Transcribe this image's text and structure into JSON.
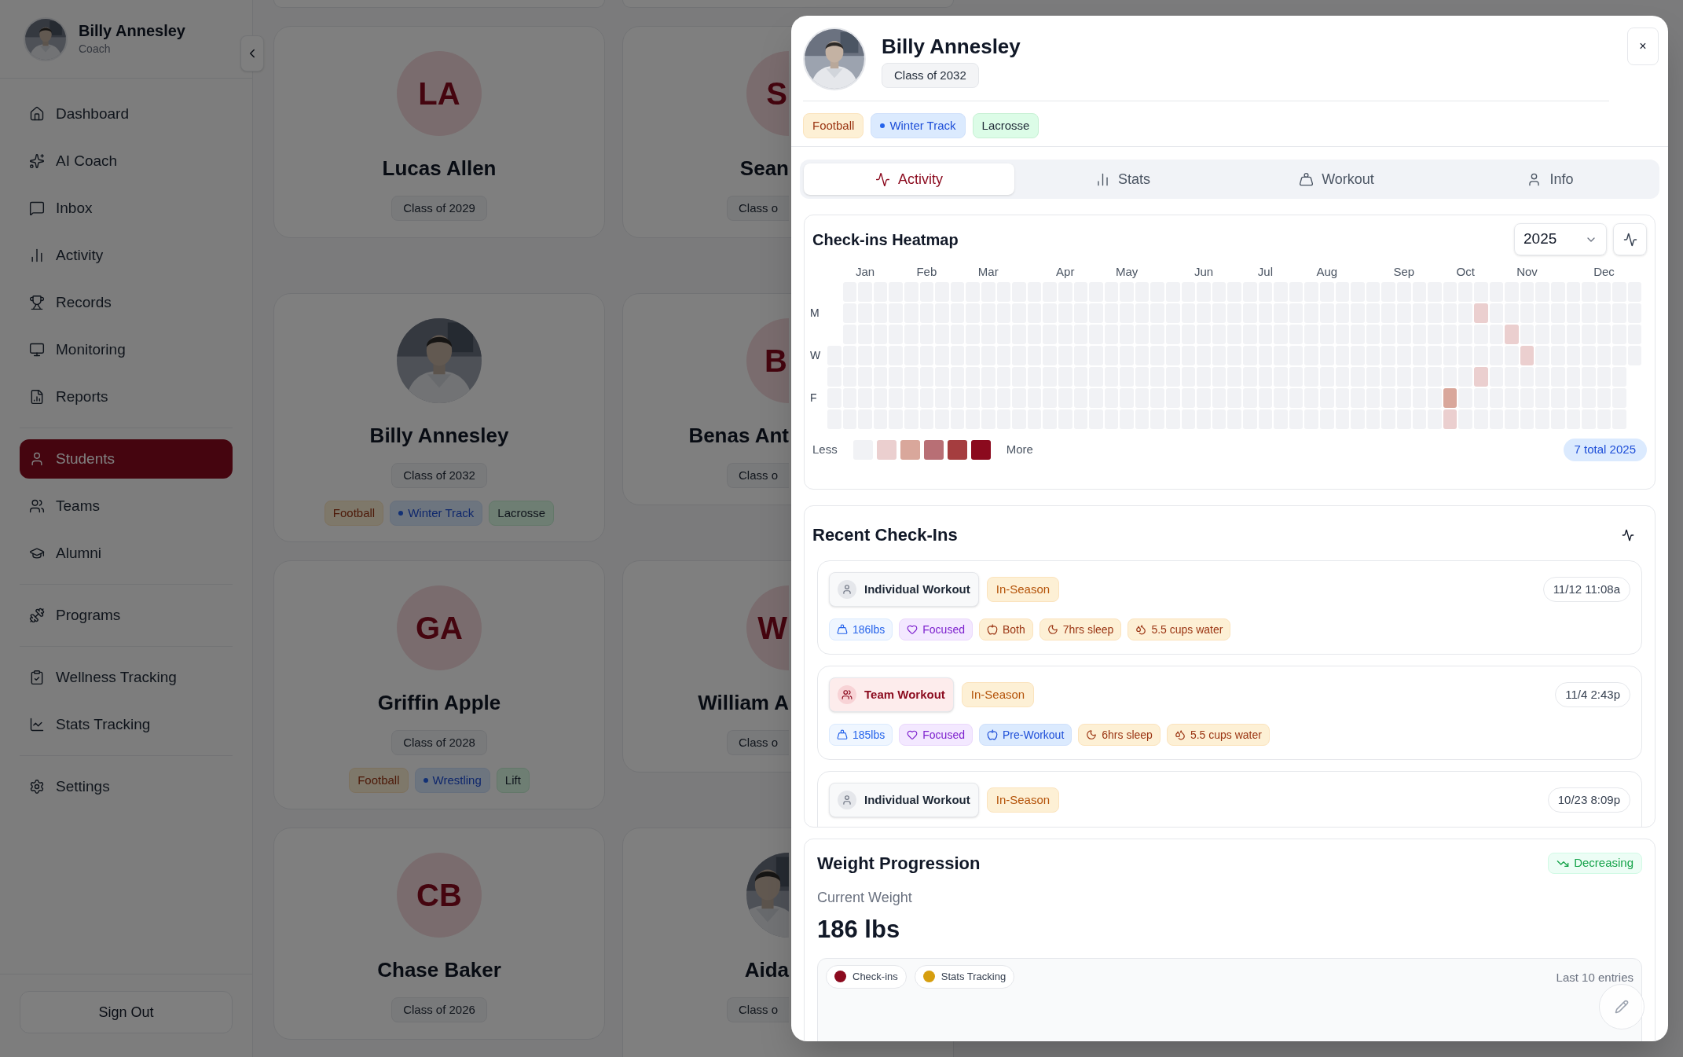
{
  "sidebar": {
    "user": {
      "name": "Billy Annesley",
      "role": "Coach"
    },
    "groups": [
      {
        "items": [
          {
            "label": "Dashboard",
            "selected": false
          },
          {
            "label": "AI Coach",
            "selected": false
          },
          {
            "label": "Inbox",
            "selected": false
          },
          {
            "label": "Activity",
            "selected": false
          },
          {
            "label": "Records",
            "selected": false
          },
          {
            "label": "Monitoring",
            "selected": false
          },
          {
            "label": "Reports",
            "selected": false
          }
        ]
      },
      {
        "items": [
          {
            "label": "Students",
            "selected": true
          },
          {
            "label": "Teams",
            "selected": false
          },
          {
            "label": "Alumni",
            "selected": false
          }
        ]
      },
      {
        "items": [
          {
            "label": "Programs",
            "selected": false
          }
        ]
      },
      {
        "items": [
          {
            "label": "Wellness Tracking",
            "selected": false
          },
          {
            "label": "Stats Tracking",
            "selected": false
          }
        ]
      },
      {
        "items": [
          {
            "label": "Settings",
            "selected": false
          }
        ]
      }
    ],
    "sign_out": "Sign Out"
  },
  "students": {
    "columns": [
      {
        "cards": [
          {
            "kind": "initials",
            "initials": "LA",
            "name": "Lucas Allen",
            "class": "Class of 2029"
          },
          {
            "name": "Billy Annesley",
            "class": "Class of 2032",
            "tags": [
              {
                "label": "Football",
                "dot": false
              },
              {
                "label": "Winter Track",
                "dot": true
              },
              {
                "label": "Lacrosse",
                "dot": false
              }
            ]
          },
          {
            "kind": "initials",
            "initials": "GA",
            "name": "Griffin Apple",
            "class": "Class of 2028",
            "tags": [
              {
                "label": "Football",
                "dot": false
              },
              {
                "label": "Wrestling",
                "dot": true
              },
              {
                "label": "Lift",
                "dot": false
              }
            ]
          },
          {
            "kind": "initials",
            "initials": "CB",
            "name": "Chase Baker",
            "class": "Class of 2026"
          }
        ]
      },
      {
        "cards": [
          {
            "kind": "initials",
            "initials": "S",
            "name": "Sean",
            "class": "Class o"
          },
          {
            "kind": "initials",
            "initials": "B",
            "name": "Benas Ant",
            "class": "Class o"
          },
          {
            "kind": "initials",
            "initials": "W",
            "name": "William A",
            "class": "Class o"
          },
          {
            "name": "Aida",
            "class": "Class o"
          }
        ]
      }
    ]
  },
  "profile": {
    "name": "Billy Annesley",
    "class": "Class of 2032",
    "close": "×",
    "tags": [
      {
        "label": "Football",
        "color": "#fdf0d5",
        "dot": false
      },
      {
        "label": "Winter Track",
        "color": "#dbeafe",
        "dot": true
      },
      {
        "label": "Lacrosse",
        "color": "#dcfce7",
        "dot": false
      }
    ],
    "tabs": [
      {
        "label": "Activity",
        "selected": true
      },
      {
        "label": "Stats",
        "selected": false
      },
      {
        "label": "Workout",
        "selected": false
      },
      {
        "label": "Info",
        "selected": false
      }
    ],
    "heatmap": {
      "title": "Check-ins Heatmap",
      "year": "2025",
      "months": [
        {
          "label": "Jan"
        },
        {
          "label": "Feb"
        },
        {
          "label": "Mar"
        },
        {
          "label": "Apr"
        },
        {
          "label": "May"
        },
        {
          "label": "Jun"
        },
        {
          "label": "Jul"
        },
        {
          "label": "Aug"
        },
        {
          "label": "Sep"
        },
        {
          "label": "Oct"
        },
        {
          "label": "Nov"
        },
        {
          "label": "Dec"
        }
      ],
      "rows": [
        {
          "cells": [
            null,
            {
              "kind": "empty"
            },
            {
              "kind": "empty"
            },
            {
              "kind": "empty"
            },
            {
              "kind": "empty"
            },
            {
              "kind": "empty"
            },
            {
              "kind": "empty"
            },
            {
              "kind": "empty"
            },
            {
              "kind": "empty"
            },
            {
              "kind": "empty"
            },
            {
              "kind": "empty"
            },
            {
              "kind": "empty"
            },
            {
              "kind": "empty"
            },
            {
              "kind": "empty"
            },
            {
              "kind": "empty"
            },
            {
              "kind": "empty"
            },
            {
              "kind": "empty"
            },
            {
              "kind": "empty"
            },
            {
              "kind": "empty"
            },
            {
              "kind": "empty"
            },
            {
              "kind": "empty"
            },
            {
              "kind": "empty"
            },
            {
              "kind": "empty"
            },
            {
              "kind": "empty"
            },
            {
              "kind": "empty"
            },
            {
              "kind": "empty"
            },
            {
              "kind": "empty"
            },
            {
              "kind": "empty"
            },
            {
              "kind": "empty"
            },
            {
              "kind": "empty"
            },
            {
              "kind": "empty"
            },
            {
              "kind": "empty"
            },
            {
              "kind": "empty"
            },
            {
              "kind": "empty"
            },
            {
              "kind": "empty"
            },
            {
              "kind": "empty"
            },
            {
              "kind": "empty"
            },
            {
              "kind": "empty"
            },
            {
              "kind": "empty"
            },
            {
              "kind": "empty"
            },
            {
              "kind": "empty"
            },
            {
              "kind": "empty"
            },
            {
              "kind": "empty"
            },
            {
              "kind": "empty"
            },
            {
              "kind": "empty"
            },
            {
              "kind": "empty"
            },
            {
              "kind": "empty"
            },
            {
              "kind": "empty"
            },
            {
              "kind": "empty"
            },
            {
              "kind": "empty"
            },
            {
              "kind": "empty"
            },
            {
              "kind": "empty"
            },
            {
              "kind": "empty"
            }
          ]
        },
        {
          "label": "M",
          "cells": [
            null,
            {
              "kind": "empty"
            },
            {
              "kind": "empty"
            },
            {
              "kind": "empty"
            },
            {
              "kind": "empty"
            },
            {
              "kind": "empty"
            },
            {
              "kind": "empty"
            },
            {
              "kind": "empty"
            },
            {
              "kind": "empty"
            },
            {
              "kind": "empty"
            },
            {
              "kind": "empty"
            },
            {
              "kind": "empty"
            },
            {
              "kind": "empty"
            },
            {
              "kind": "empty"
            },
            {
              "kind": "empty"
            },
            {
              "kind": "empty"
            },
            {
              "kind": "empty"
            },
            {
              "kind": "empty"
            },
            {
              "kind": "empty"
            },
            {
              "kind": "empty"
            },
            {
              "kind": "empty"
            },
            {
              "kind": "empty"
            },
            {
              "kind": "empty"
            },
            {
              "kind": "empty"
            },
            {
              "kind": "empty"
            },
            {
              "kind": "empty"
            },
            {
              "kind": "empty"
            },
            {
              "kind": "empty"
            },
            {
              "kind": "empty"
            },
            {
              "kind": "empty"
            },
            {
              "kind": "empty"
            },
            {
              "kind": "empty"
            },
            {
              "kind": "empty"
            },
            {
              "kind": "empty"
            },
            {
              "kind": "empty"
            },
            {
              "kind": "empty"
            },
            {
              "kind": "empty"
            },
            {
              "kind": "empty"
            },
            {
              "kind": "empty"
            },
            {
              "kind": "empty"
            },
            {
              "kind": "empty"
            },
            {
              "kind": "empty"
            },
            {
              "kind": "light"
            },
            {
              "kind": "empty"
            },
            {
              "kind": "empty"
            },
            {
              "kind": "empty"
            },
            {
              "kind": "empty"
            },
            {
              "kind": "empty"
            },
            {
              "kind": "empty"
            },
            {
              "kind": "empty"
            },
            {
              "kind": "empty"
            },
            {
              "kind": "empty"
            },
            {
              "kind": "empty"
            }
          ]
        },
        {
          "cells": [
            null,
            {
              "kind": "empty"
            },
            {
              "kind": "empty"
            },
            {
              "kind": "empty"
            },
            {
              "kind": "empty"
            },
            {
              "kind": "empty"
            },
            {
              "kind": "empty"
            },
            {
              "kind": "empty"
            },
            {
              "kind": "empty"
            },
            {
              "kind": "empty"
            },
            {
              "kind": "empty"
            },
            {
              "kind": "empty"
            },
            {
              "kind": "empty"
            },
            {
              "kind": "empty"
            },
            {
              "kind": "empty"
            },
            {
              "kind": "empty"
            },
            {
              "kind": "empty"
            },
            {
              "kind": "empty"
            },
            {
              "kind": "empty"
            },
            {
              "kind": "empty"
            },
            {
              "kind": "empty"
            },
            {
              "kind": "empty"
            },
            {
              "kind": "empty"
            },
            {
              "kind": "empty"
            },
            {
              "kind": "empty"
            },
            {
              "kind": "empty"
            },
            {
              "kind": "empty"
            },
            {
              "kind": "empty"
            },
            {
              "kind": "empty"
            },
            {
              "kind": "empty"
            },
            {
              "kind": "empty"
            },
            {
              "kind": "empty"
            },
            {
              "kind": "empty"
            },
            {
              "kind": "empty"
            },
            {
              "kind": "empty"
            },
            {
              "kind": "empty"
            },
            {
              "kind": "empty"
            },
            {
              "kind": "empty"
            },
            {
              "kind": "empty"
            },
            {
              "kind": "empty"
            },
            {
              "kind": "empty"
            },
            {
              "kind": "empty"
            },
            {
              "kind": "empty"
            },
            {
              "kind": "empty"
            },
            {
              "kind": "light"
            },
            {
              "kind": "empty"
            },
            {
              "kind": "empty"
            },
            {
              "kind": "empty"
            },
            {
              "kind": "empty"
            },
            {
              "kind": "empty"
            },
            {
              "kind": "empty"
            },
            {
              "kind": "empty"
            },
            {
              "kind": "empty"
            }
          ]
        },
        {
          "label": "W",
          "cells": [
            {
              "kind": "empty"
            },
            {
              "kind": "empty"
            },
            {
              "kind": "empty"
            },
            {
              "kind": "empty"
            },
            {
              "kind": "empty"
            },
            {
              "kind": "empty"
            },
            {
              "kind": "empty"
            },
            {
              "kind": "empty"
            },
            {
              "kind": "empty"
            },
            {
              "kind": "empty"
            },
            {
              "kind": "empty"
            },
            {
              "kind": "empty"
            },
            {
              "kind": "empty"
            },
            {
              "kind": "empty"
            },
            {
              "kind": "empty"
            },
            {
              "kind": "empty"
            },
            {
              "kind": "empty"
            },
            {
              "kind": "empty"
            },
            {
              "kind": "empty"
            },
            {
              "kind": "empty"
            },
            {
              "kind": "empty"
            },
            {
              "kind": "empty"
            },
            {
              "kind": "empty"
            },
            {
              "kind": "empty"
            },
            {
              "kind": "empty"
            },
            {
              "kind": "empty"
            },
            {
              "kind": "empty"
            },
            {
              "kind": "empty"
            },
            {
              "kind": "empty"
            },
            {
              "kind": "empty"
            },
            {
              "kind": "empty"
            },
            {
              "kind": "empty"
            },
            {
              "kind": "empty"
            },
            {
              "kind": "empty"
            },
            {
              "kind": "empty"
            },
            {
              "kind": "empty"
            },
            {
              "kind": "empty"
            },
            {
              "kind": "empty"
            },
            {
              "kind": "empty"
            },
            {
              "kind": "empty"
            },
            {
              "kind": "empty"
            },
            {
              "kind": "empty"
            },
            {
              "kind": "empty"
            },
            {
              "kind": "empty"
            },
            {
              "kind": "empty"
            },
            {
              "kind": "light"
            },
            {
              "kind": "empty"
            },
            {
              "kind": "empty"
            },
            {
              "kind": "empty"
            },
            {
              "kind": "empty"
            },
            {
              "kind": "empty"
            },
            {
              "kind": "empty"
            },
            {
              "kind": "empty"
            }
          ]
        },
        {
          "cells": [
            {
              "kind": "empty"
            },
            {
              "kind": "empty"
            },
            {
              "kind": "empty"
            },
            {
              "kind": "empty"
            },
            {
              "kind": "empty"
            },
            {
              "kind": "empty"
            },
            {
              "kind": "empty"
            },
            {
              "kind": "empty"
            },
            {
              "kind": "empty"
            },
            {
              "kind": "empty"
            },
            {
              "kind": "empty"
            },
            {
              "kind": "empty"
            },
            {
              "kind": "empty"
            },
            {
              "kind": "empty"
            },
            {
              "kind": "empty"
            },
            {
              "kind": "empty"
            },
            {
              "kind": "empty"
            },
            {
              "kind": "empty"
            },
            {
              "kind": "empty"
            },
            {
              "kind": "empty"
            },
            {
              "kind": "empty"
            },
            {
              "kind": "empty"
            },
            {
              "kind": "empty"
            },
            {
              "kind": "empty"
            },
            {
              "kind": "empty"
            },
            {
              "kind": "empty"
            },
            {
              "kind": "empty"
            },
            {
              "kind": "empty"
            },
            {
              "kind": "empty"
            },
            {
              "kind": "empty"
            },
            {
              "kind": "empty"
            },
            {
              "kind": "empty"
            },
            {
              "kind": "empty"
            },
            {
              "kind": "empty"
            },
            {
              "kind": "empty"
            },
            {
              "kind": "empty"
            },
            {
              "kind": "empty"
            },
            {
              "kind": "empty"
            },
            {
              "kind": "empty"
            },
            {
              "kind": "empty"
            },
            {
              "kind": "empty"
            },
            {
              "kind": "empty"
            },
            {
              "kind": "light"
            },
            {
              "kind": "empty"
            },
            {
              "kind": "empty"
            },
            {
              "kind": "empty"
            },
            {
              "kind": "empty"
            },
            {
              "kind": "empty"
            },
            {
              "kind": "empty"
            },
            {
              "kind": "empty"
            },
            {
              "kind": "empty"
            },
            {
              "kind": "empty"
            },
            null
          ]
        },
        {
          "label": "F",
          "cells": [
            {
              "kind": "empty"
            },
            {
              "kind": "empty"
            },
            {
              "kind": "empty"
            },
            {
              "kind": "empty"
            },
            {
              "kind": "empty"
            },
            {
              "kind": "empty"
            },
            {
              "kind": "empty"
            },
            {
              "kind": "empty"
            },
            {
              "kind": "empty"
            },
            {
              "kind": "empty"
            },
            {
              "kind": "empty"
            },
            {
              "kind": "empty"
            },
            {
              "kind": "empty"
            },
            {
              "kind": "empty"
            },
            {
              "kind": "empty"
            },
            {
              "kind": "empty"
            },
            {
              "kind": "empty"
            },
            {
              "kind": "empty"
            },
            {
              "kind": "empty"
            },
            {
              "kind": "empty"
            },
            {
              "kind": "empty"
            },
            {
              "kind": "empty"
            },
            {
              "kind": "empty"
            },
            {
              "kind": "empty"
            },
            {
              "kind": "empty"
            },
            {
              "kind": "empty"
            },
            {
              "kind": "empty"
            },
            {
              "kind": "empty"
            },
            {
              "kind": "empty"
            },
            {
              "kind": "empty"
            },
            {
              "kind": "empty"
            },
            {
              "kind": "empty"
            },
            {
              "kind": "empty"
            },
            {
              "kind": "empty"
            },
            {
              "kind": "empty"
            },
            {
              "kind": "empty"
            },
            {
              "kind": "empty"
            },
            {
              "kind": "empty"
            },
            {
              "kind": "empty"
            },
            {
              "kind": "empty"
            },
            {
              "kind": "medium"
            },
            {
              "kind": "empty"
            },
            {
              "kind": "empty"
            },
            {
              "kind": "empty"
            },
            {
              "kind": "empty"
            },
            {
              "kind": "empty"
            },
            {
              "kind": "empty"
            },
            {
              "kind": "empty"
            },
            {
              "kind": "empty"
            },
            {
              "kind": "empty"
            },
            {
              "kind": "empty"
            },
            {
              "kind": "empty"
            },
            null
          ]
        },
        {
          "cells": [
            {
              "kind": "empty"
            },
            {
              "kind": "empty"
            },
            {
              "kind": "empty"
            },
            {
              "kind": "empty"
            },
            {
              "kind": "empty"
            },
            {
              "kind": "empty"
            },
            {
              "kind": "empty"
            },
            {
              "kind": "empty"
            },
            {
              "kind": "empty"
            },
            {
              "kind": "empty"
            },
            {
              "kind": "empty"
            },
            {
              "kind": "empty"
            },
            {
              "kind": "empty"
            },
            {
              "kind": "empty"
            },
            {
              "kind": "empty"
            },
            {
              "kind": "empty"
            },
            {
              "kind": "empty"
            },
            {
              "kind": "empty"
            },
            {
              "kind": "empty"
            },
            {
              "kind": "empty"
            },
            {
              "kind": "empty"
            },
            {
              "kind": "empty"
            },
            {
              "kind": "empty"
            },
            {
              "kind": "empty"
            },
            {
              "kind": "empty"
            },
            {
              "kind": "empty"
            },
            {
              "kind": "empty"
            },
            {
              "kind": "empty"
            },
            {
              "kind": "empty"
            },
            {
              "kind": "empty"
            },
            {
              "kind": "empty"
            },
            {
              "kind": "empty"
            },
            {
              "kind": "empty"
            },
            {
              "kind": "empty"
            },
            {
              "kind": "empty"
            },
            {
              "kind": "empty"
            },
            {
              "kind": "empty"
            },
            {
              "kind": "empty"
            },
            {
              "kind": "empty"
            },
            {
              "kind": "empty"
            },
            {
              "kind": "light"
            },
            {
              "kind": "empty"
            },
            {
              "kind": "empty"
            },
            {
              "kind": "empty"
            },
            {
              "kind": "empty"
            },
            {
              "kind": "empty"
            },
            {
              "kind": "empty"
            },
            {
              "kind": "empty"
            },
            {
              "kind": "empty"
            },
            {
              "kind": "empty"
            },
            {
              "kind": "empty"
            },
            {
              "kind": "empty"
            },
            null
          ]
        }
      ],
      "legend": {
        "start": "Less",
        "end": "More",
        "steps": [
          {
            "kind": "empty"
          },
          {
            "kind": "light"
          },
          {
            "kind": "medium"
          },
          {
            "kind": "strong"
          },
          {
            "kind": "heavy"
          },
          {
            "kind": "full"
          }
        ]
      },
      "total": "7 total 2025"
    },
    "checkins": {
      "title": "Recent Check-Ins",
      "items": [
        {
          "kind": "individual",
          "label": "Individual Workout",
          "phase": "In-Season",
          "time": "11/12 11:08a",
          "metrics": [
            {
              "kind": "weight",
              "label": "186lbs",
              "color": "#eff6ff"
            },
            {
              "kind": "mood",
              "label": "Focused",
              "color": "#f3e8ff"
            },
            {
              "kind": "nutrition",
              "label": "Both",
              "color": "#fdf0d5"
            },
            {
              "kind": "sleep",
              "label": "7hrs sleep",
              "color": "#fdf0d5"
            },
            {
              "kind": "water",
              "label": "5.5 cups water",
              "color": "#fdf0d5"
            }
          ]
        },
        {
          "kind": "team",
          "label": "Team Workout",
          "phase": "In-Season",
          "time": "11/4 2:43p",
          "metrics": [
            {
              "kind": "weight",
              "label": "185lbs",
              "color": "#eff6ff"
            },
            {
              "kind": "mood",
              "label": "Focused",
              "color": "#f3e8ff"
            },
            {
              "kind": "nutrition",
              "label": "Pre-Workout",
              "color": "#dbeafe"
            },
            {
              "kind": "sleep",
              "label": "6hrs sleep",
              "color": "#fdf0d5"
            },
            {
              "kind": "water",
              "label": "5.5 cups water",
              "color": "#fdf0d5"
            }
          ]
        },
        {
          "kind": "individual",
          "label": "Individual Workout",
          "phase": "In-Season",
          "time": "10/23 8:09p"
        }
      ]
    },
    "weight": {
      "title": "Weight Progression",
      "trend": "Decreasing",
      "current_label": "Current Weight",
      "current": "186 lbs",
      "legend": [
        {
          "label": "Check-ins",
          "color": "#8b0a1e"
        },
        {
          "label": "Stats Tracking",
          "color": "#d69e0f"
        }
      ],
      "range": "Last 10 entries"
    }
  }
}
